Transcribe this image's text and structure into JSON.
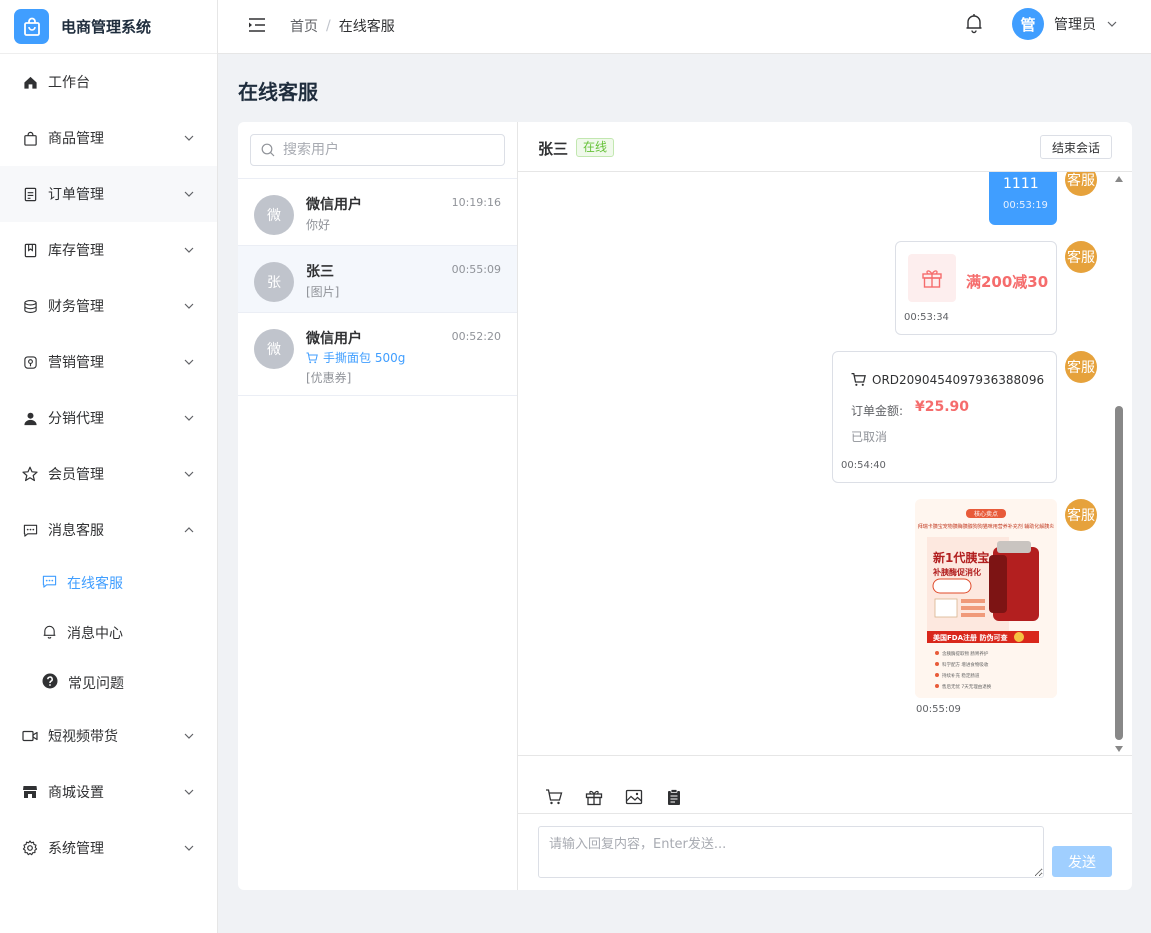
{
  "app": {
    "title": "电商管理系统"
  },
  "header": {
    "breadcrumb_home": "首页",
    "breadcrumb_sep": "/",
    "breadcrumb_current": "在线客服",
    "avatar_text": "管",
    "user_name": "管理员"
  },
  "sidebar": {
    "items": [
      {
        "label": "工作台",
        "icon": "home-icon"
      },
      {
        "label": "商品管理",
        "icon": "bag-icon"
      },
      {
        "label": "订单管理",
        "icon": "document-icon"
      },
      {
        "label": "库存管理",
        "icon": "bookmark-icon"
      },
      {
        "label": "财务管理",
        "icon": "coins-icon"
      },
      {
        "label": "营销管理",
        "icon": "location-icon"
      },
      {
        "label": "分销代理",
        "icon": "user-icon"
      },
      {
        "label": "会员管理",
        "icon": "star-icon"
      },
      {
        "label": "消息客服",
        "icon": "chat-icon"
      },
      {
        "label": "短视频带货",
        "icon": "video-icon"
      },
      {
        "label": "商城设置",
        "icon": "shop-icon"
      },
      {
        "label": "系统管理",
        "icon": "gear-icon"
      }
    ],
    "subitems": [
      {
        "label": "在线客服",
        "icon": "chat-dots-icon"
      },
      {
        "label": "消息中心",
        "icon": "bell-icon"
      },
      {
        "label": "常见问题",
        "icon": "question-icon"
      }
    ]
  },
  "page": {
    "title": "在线客服"
  },
  "search": {
    "placeholder": "搜索用户"
  },
  "conversations": [
    {
      "avatar": "微",
      "name": "微信用户",
      "time": "10:19:16",
      "preview": "你好"
    },
    {
      "avatar": "张",
      "name": "张三",
      "time": "00:55:09",
      "preview": "[图片]"
    },
    {
      "avatar": "微",
      "name": "微信用户",
      "time": "00:52:20",
      "product": "手撕面包 500g",
      "preview": "[优惠券]"
    }
  ],
  "chat": {
    "user": "张三",
    "status": "在线",
    "end_button": "结束会话",
    "agent_label": "客服",
    "messages": {
      "text": {
        "content": "1111",
        "time": "00:53:19"
      },
      "coupon": {
        "content": "满200减30",
        "time": "00:53:34"
      },
      "order": {
        "order_no": "ORD2090454097936388096",
        "amount_label": "订单金额:",
        "amount": "¥25.90",
        "status": "已取消",
        "time": "00:54:40"
      },
      "image": {
        "time": "00:55:09",
        "banner": "核心卖点",
        "headline": "拜瑞卡胰宝宠物胰酶胰腺狗狗猫咪用营养补充剂 辅助化解胰炎",
        "main1": "新1代胰宝",
        "main2": "补胰酶促消化",
        "badge": "美国FDA注册 防伪可查",
        "bullets": [
          "含胰酶提取物 肠胃养护",
          "科学配方 增进食物吸收",
          "持续补充 稳定肠道",
          "售后无忧 7天无理由退换"
        ]
      }
    }
  },
  "composer": {
    "placeholder": "请输入回复内容，Enter发送...",
    "send_label": "发送"
  },
  "colors": {
    "primary": "#409eff",
    "agent": "#e6a23c",
    "price": "#f56c6c",
    "online": "#67c23a"
  }
}
